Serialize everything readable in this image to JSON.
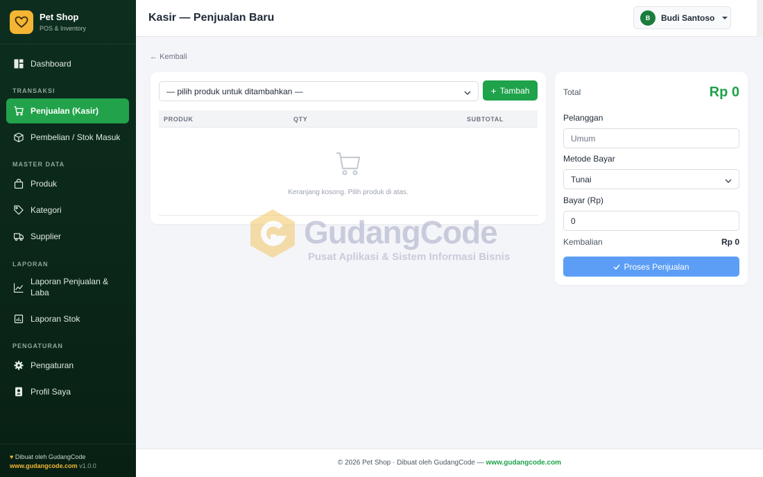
{
  "brand": {
    "name": "Pet Shop",
    "subtitle": "POS & Inventory"
  },
  "sidebar": {
    "dashboard": "Dashboard",
    "sections": {
      "transaksi": "TRANSAKSI",
      "master": "MASTER DATA",
      "laporan": "LAPORAN",
      "pengaturan": "PENGATURAN"
    },
    "items": {
      "penjualan": "Penjualan (Kasir)",
      "pembelian": "Pembelian / Stok Masuk",
      "produk": "Produk",
      "kategori": "Kategori",
      "supplier": "Supplier",
      "laporan_penjualan_1": "Laporan Penjualan &",
      "laporan_penjualan_2": "Laba",
      "laporan_stok": "Laporan Stok",
      "pengaturan": "Pengaturan",
      "profil": "Profil Saya"
    },
    "footer": {
      "made_by": "Dibuat oleh GudangCode",
      "site": "www.gudangcode.com",
      "version": "v1.0.0"
    }
  },
  "header": {
    "title": "Kasir — Penjualan Baru",
    "user_initial": "B",
    "user_name": "Budi Santoso"
  },
  "main": {
    "back": "Kembali",
    "product_select": "— pilih produk untuk ditambahkan —",
    "add_button": "Tambah",
    "table": {
      "col_product": "PRODUK",
      "col_qty": "QTY",
      "col_subtotal": "SUBTOTAL"
    },
    "empty_text": "Keranjang kosong. Pilih produk di atas."
  },
  "summary": {
    "total_label": "Total",
    "total_value": "Rp 0",
    "customer_label": "Pelanggan",
    "customer_placeholder": "Umum",
    "payment_label": "Metode Bayar",
    "payment_value": "Tunai",
    "pay_label": "Bayar (Rp)",
    "pay_value": "0",
    "change_label": "Kembalian",
    "change_value": "Rp 0",
    "submit": "Proses Penjualan"
  },
  "watermark": {
    "title": "GudangCode",
    "subtitle": "Pusat Aplikasi & Sistem Informasi Bisnis"
  },
  "footer": {
    "copyright": "© 2026 Pet Shop · Dibuat oleh GudangCode — ",
    "site": "www.gudangcode.com"
  },
  "colors": {
    "primary": "#1ea24a",
    "sidebar_bg": "#0d2e1f",
    "accent": "#f3b533",
    "submit": "#5c9ef5"
  }
}
